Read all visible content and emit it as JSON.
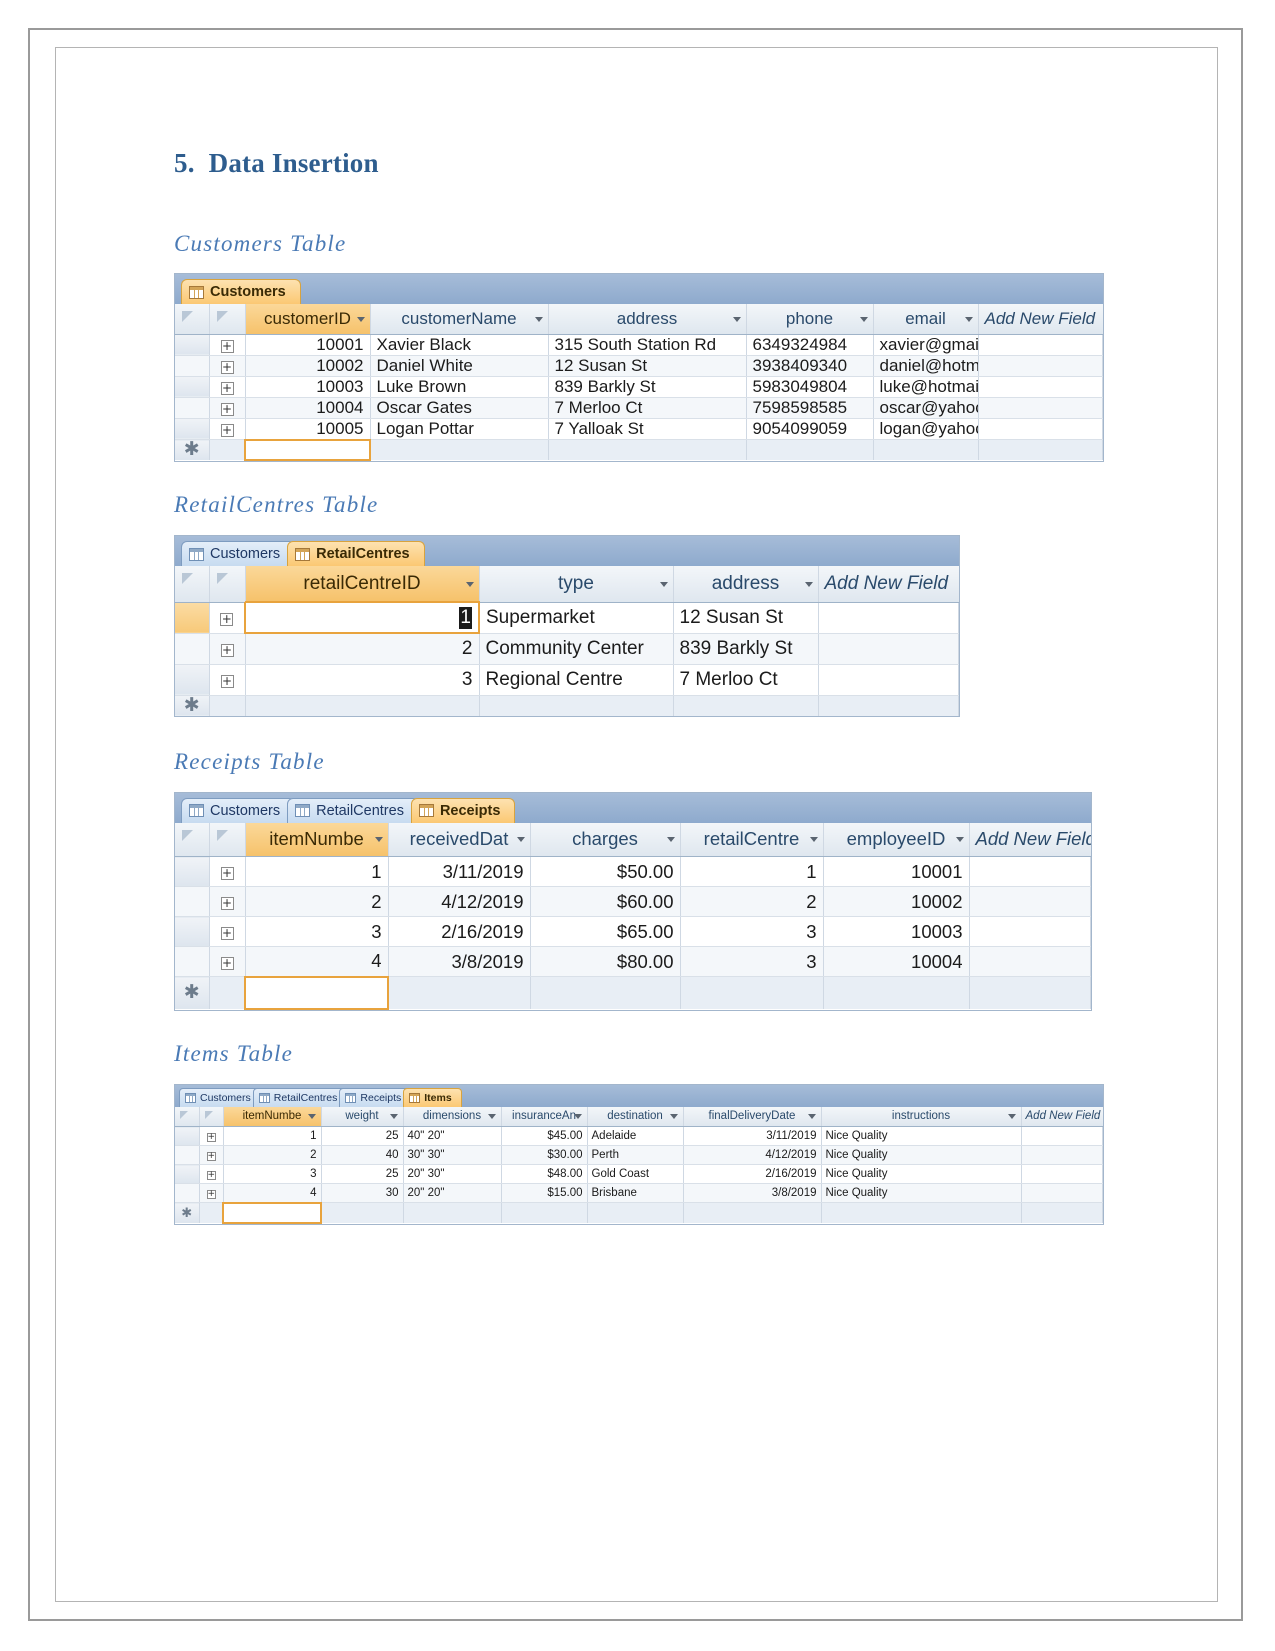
{
  "document": {
    "section_number": "5.",
    "section_title": "Data Insertion"
  },
  "sections": [
    {
      "heading": "Customers Table"
    },
    {
      "heading": "RetailCentres Table"
    },
    {
      "heading": "Receipts Table"
    },
    {
      "heading": "Items Table"
    }
  ],
  "add_new_field_label": "Add New Field",
  "new_row_marker": "✱",
  "expand_glyph": "+",
  "customers": {
    "tabs": [
      {
        "label": "Customers",
        "active": true
      }
    ],
    "columns": [
      {
        "label": "customerID",
        "key": true
      },
      {
        "label": "customerName",
        "key": false
      },
      {
        "label": "address",
        "key": false
      },
      {
        "label": "phone",
        "key": false
      },
      {
        "label": "email",
        "key": false
      }
    ],
    "rows": [
      {
        "customerID": "10001",
        "customerName": "Xavier Black",
        "address": "315 South Station Rd",
        "phone": "6349324984",
        "email": "xavier@gmail.c"
      },
      {
        "customerID": "10002",
        "customerName": "Daniel White",
        "address": "12 Susan St",
        "phone": "3938409340",
        "email": "daniel@hotma"
      },
      {
        "customerID": "10003",
        "customerName": "Luke Brown",
        "address": "839 Barkly St",
        "phone": "5983049804",
        "email": "luke@hotmail."
      },
      {
        "customerID": "10004",
        "customerName": "Oscar Gates",
        "address": "7 Merloo Ct",
        "phone": "7598598585",
        "email": "oscar@yahoo.c"
      },
      {
        "customerID": "10005",
        "customerName": "Logan Pottar",
        "address": "7 Yalloak St",
        "phone": "9054099059",
        "email": "logan@yahoo.c"
      }
    ]
  },
  "retailcentres": {
    "tabs": [
      {
        "label": "Customers",
        "active": false
      },
      {
        "label": "RetailCentres",
        "active": true
      }
    ],
    "columns": [
      {
        "label": "retailCentreID",
        "key": true
      },
      {
        "label": "type",
        "key": false
      },
      {
        "label": "address",
        "key": false
      }
    ],
    "rows": [
      {
        "retailCentreID": "1",
        "type": "Supermarket",
        "address": "12 Susan St",
        "selected": true
      },
      {
        "retailCentreID": "2",
        "type": "Community Center",
        "address": "839 Barkly St",
        "selected": false
      },
      {
        "retailCentreID": "3",
        "type": "Regional Centre",
        "address": "7 Merloo Ct",
        "selected": false
      }
    ]
  },
  "receipts": {
    "tabs": [
      {
        "label": "Customers",
        "active": false
      },
      {
        "label": "RetailCentres",
        "active": false
      },
      {
        "label": "Receipts",
        "active": true
      }
    ],
    "columns": [
      {
        "label": "itemNumbe",
        "key": true
      },
      {
        "label": "receivedDat",
        "key": false
      },
      {
        "label": "charges",
        "key": false
      },
      {
        "label": "retailCentre",
        "key": false
      },
      {
        "label": "employeeID",
        "key": false
      }
    ],
    "rows": [
      {
        "itemNumber": "1",
        "receivedDate": "3/11/2019",
        "charges": "$50.00",
        "retailCentre": "1",
        "employeeID": "10001"
      },
      {
        "itemNumber": "2",
        "receivedDate": "4/12/2019",
        "charges": "$60.00",
        "retailCentre": "2",
        "employeeID": "10002"
      },
      {
        "itemNumber": "3",
        "receivedDate": "2/16/2019",
        "charges": "$65.00",
        "retailCentre": "3",
        "employeeID": "10003"
      },
      {
        "itemNumber": "4",
        "receivedDate": "3/8/2019",
        "charges": "$80.00",
        "retailCentre": "3",
        "employeeID": "10004"
      }
    ]
  },
  "items": {
    "tabs": [
      {
        "label": "Customers",
        "active": false
      },
      {
        "label": "RetailCentres",
        "active": false
      },
      {
        "label": "Receipts",
        "active": false
      },
      {
        "label": "Items",
        "active": true
      }
    ],
    "columns": [
      {
        "label": "itemNumbe",
        "key": true
      },
      {
        "label": "weight",
        "key": false
      },
      {
        "label": "dimensions",
        "key": false
      },
      {
        "label": "insuranceAn",
        "key": false
      },
      {
        "label": "destination",
        "key": false
      },
      {
        "label": "finalDeliveryDate",
        "key": false
      },
      {
        "label": "instructions",
        "key": false
      }
    ],
    "rows": [
      {
        "itemNumber": "1",
        "weight": "25",
        "dimensions": "40\" 20\"",
        "insuranceAmount": "$45.00",
        "destination": "Adelaide",
        "finalDeliveryDate": "3/11/2019",
        "instructions": "Nice Quality"
      },
      {
        "itemNumber": "2",
        "weight": "40",
        "dimensions": "30\" 30\"",
        "insuranceAmount": "$30.00",
        "destination": "Perth",
        "finalDeliveryDate": "4/12/2019",
        "instructions": "Nice Quality"
      },
      {
        "itemNumber": "3",
        "weight": "25",
        "dimensions": "20\" 30\"",
        "insuranceAmount": "$48.00",
        "destination": "Gold Coast",
        "finalDeliveryDate": "2/16/2019",
        "instructions": "Nice Quality"
      },
      {
        "itemNumber": "4",
        "weight": "30",
        "dimensions": "20\" 20\"",
        "insuranceAmount": "$15.00",
        "destination": "Brisbane",
        "finalDeliveryDate": "3/8/2019",
        "instructions": "Nice Quality"
      }
    ]
  },
  "colors": {
    "heading_blue": "#2e5d8e",
    "subheading_blue": "#4a7ab5",
    "tab_active_orange": "#fbc873",
    "key_column_orange": "#f6c26b",
    "tabstrip_blue": "#93aed0"
  }
}
